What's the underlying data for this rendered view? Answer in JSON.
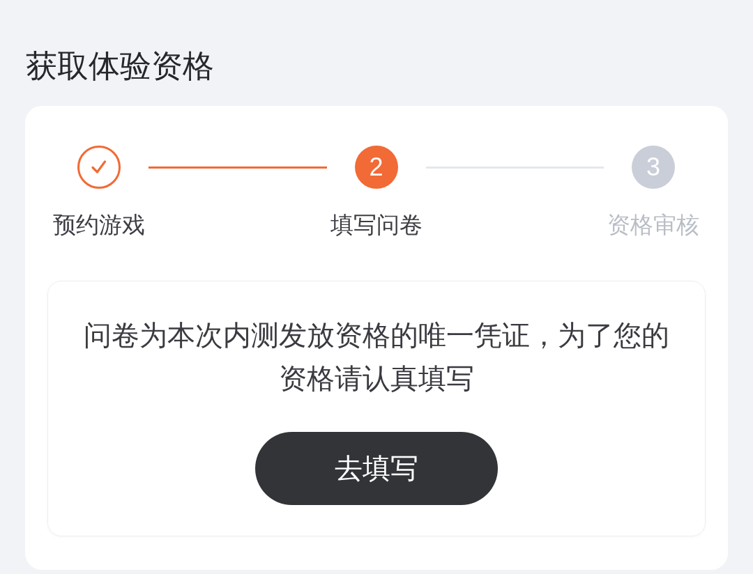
{
  "page": {
    "title": "获取体验资格"
  },
  "steps": [
    {
      "label": "预约游戏",
      "kind": "done"
    },
    {
      "label": "填写问卷",
      "kind": "current",
      "number": "2"
    },
    {
      "label": "资格审核",
      "kind": "pending",
      "number": "3"
    }
  ],
  "notice": {
    "text": "问卷为本次内测发放资格的唯一凭证，为了您的资格请认真填写",
    "button": "去填写"
  }
}
